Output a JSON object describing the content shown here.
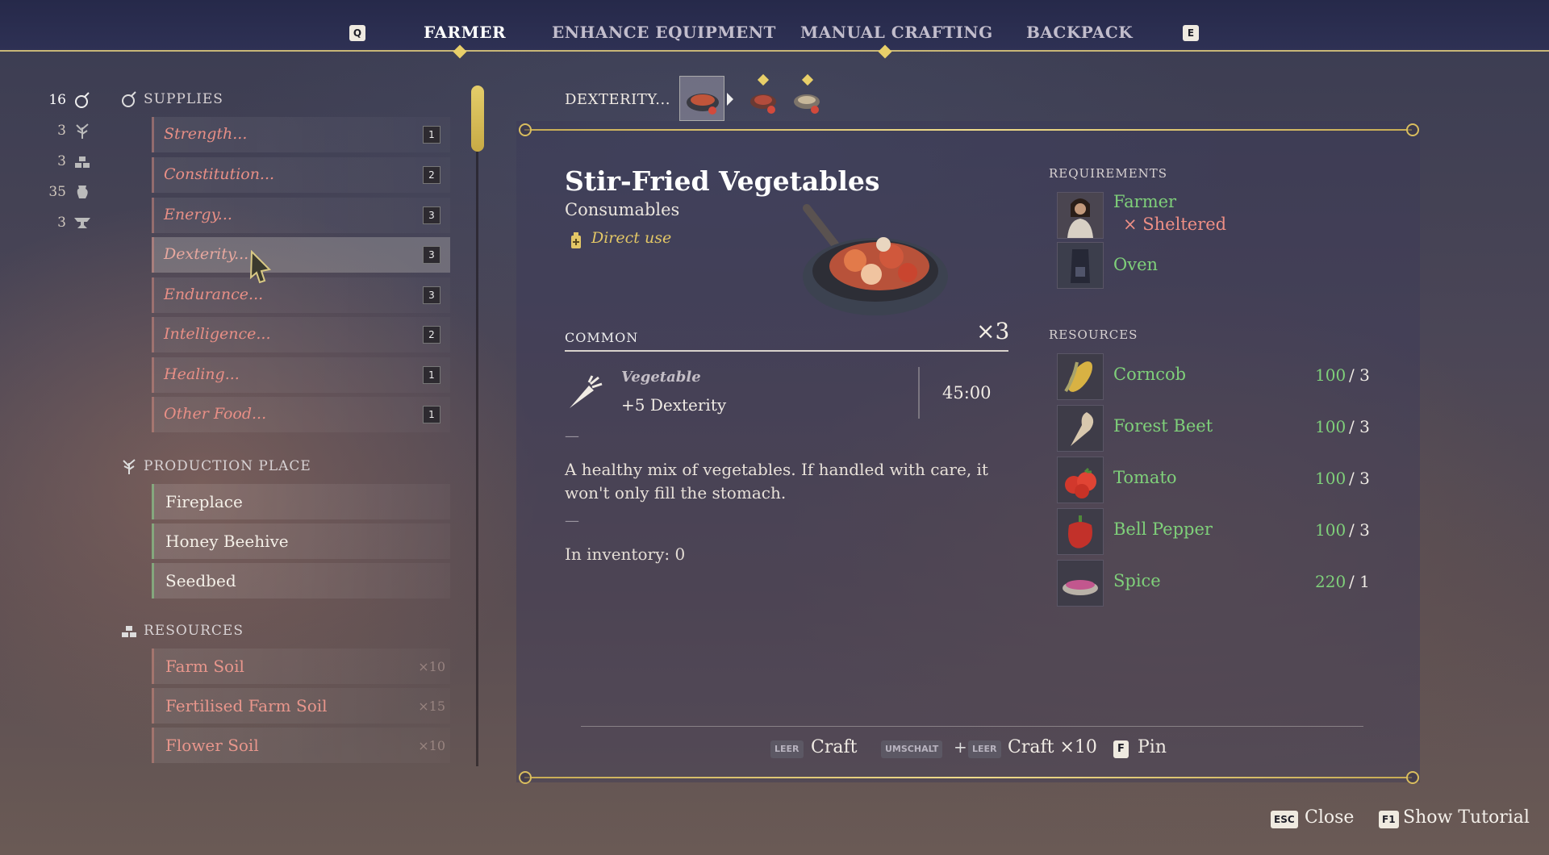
{
  "top_tabs": {
    "left_key": "Q",
    "right_key": "E",
    "items": [
      {
        "label": "FARMER",
        "active": true
      },
      {
        "label": "ENHANCE EQUIPMENT",
        "active": false
      },
      {
        "label": "MANUAL CRAFTING",
        "active": false
      },
      {
        "label": "BACKPACK",
        "active": false
      }
    ]
  },
  "stats": [
    {
      "value": "16",
      "icon": "potion-icon"
    },
    {
      "value": "3",
      "icon": "sprout-icon"
    },
    {
      "value": "3",
      "icon": "ingots-icon"
    },
    {
      "value": "35",
      "icon": "jug-icon"
    },
    {
      "value": "3",
      "icon": "anvil-icon"
    }
  ],
  "sidebar": {
    "supplies_heading": "SUPPLIES",
    "supplies": [
      {
        "label": "Strength...",
        "count": "1"
      },
      {
        "label": "Constitution...",
        "count": "2"
      },
      {
        "label": "Energy...",
        "count": "3"
      },
      {
        "label": "Dexterity...",
        "count": "3",
        "selected": true
      },
      {
        "label": "Endurance...",
        "count": "3"
      },
      {
        "label": "Intelligence...",
        "count": "2"
      },
      {
        "label": "Healing...",
        "count": "1"
      },
      {
        "label": "Other Food...",
        "count": "1"
      }
    ],
    "places_heading": "PRODUCTION PLACE",
    "places": [
      {
        "label": "Fireplace"
      },
      {
        "label": "Honey Beehive"
      },
      {
        "label": "Seedbed"
      }
    ],
    "resources_heading": "RESOURCES",
    "resources": [
      {
        "label": "Farm Soil",
        "qty": "×10"
      },
      {
        "label": "Fertilised Farm Soil",
        "qty": "×15"
      },
      {
        "label": "Flower Soil",
        "qty": "×10"
      }
    ]
  },
  "recipe": {
    "breadcrumb": "DEXTERITY...",
    "thumbnails": [
      "stir-fried-vegetables-icon",
      "meat-dish-icon",
      "stew-bowl-icon"
    ],
    "title": "Stir-Fried Vegetables",
    "category": "Consumables",
    "usage": "Direct use",
    "rarity": "COMMON",
    "multiplier": "×3",
    "effect": {
      "type": "Vegetable",
      "bonus": "+5 Dexterity",
      "duration": "45:00"
    },
    "dash": "—",
    "description": "A healthy mix of vegetables. If handled with care, it won't only fill the stomach.",
    "inventory": "In inventory: 0"
  },
  "requirements": {
    "heading": "REQUIREMENTS",
    "items": [
      {
        "name": "Farmer",
        "sub": "× Sheltered",
        "icon": "farmer-portrait-icon"
      },
      {
        "name": "Oven",
        "icon": "oven-icon"
      }
    ]
  },
  "resources": {
    "heading": "RESOURCES",
    "items": [
      {
        "name": "Corncob",
        "have": "100",
        "need": "/ 3",
        "icon": "corncob-icon"
      },
      {
        "name": "Forest Beet",
        "have": "100",
        "need": "/ 3",
        "icon": "forest-beet-icon"
      },
      {
        "name": "Tomato",
        "have": "100",
        "need": "/ 3",
        "icon": "tomato-icon"
      },
      {
        "name": "Bell Pepper",
        "have": "100",
        "need": "/ 3",
        "icon": "bell-pepper-icon"
      },
      {
        "name": "Spice",
        "have": "220",
        "need": "/ 1",
        "icon": "spice-icon"
      }
    ]
  },
  "actions": {
    "craft_key": "LEER",
    "craft_label": "Craft",
    "craft10_mod_key": "UMSCHALT",
    "plus": "+",
    "craft10_key": "LEER",
    "craft10_label": "Craft ×10",
    "pin_key": "F",
    "pin_label": "Pin"
  },
  "footer": {
    "close_key": "ESC",
    "close_label": "Close",
    "tutorial_key": "F1",
    "tutorial_label": "Show Tutorial"
  },
  "colors": {
    "gold": "#e8cf69",
    "available_green": "#7fd07a",
    "unavailable_red": "#ee8f85",
    "topbar": "#2e3154"
  }
}
